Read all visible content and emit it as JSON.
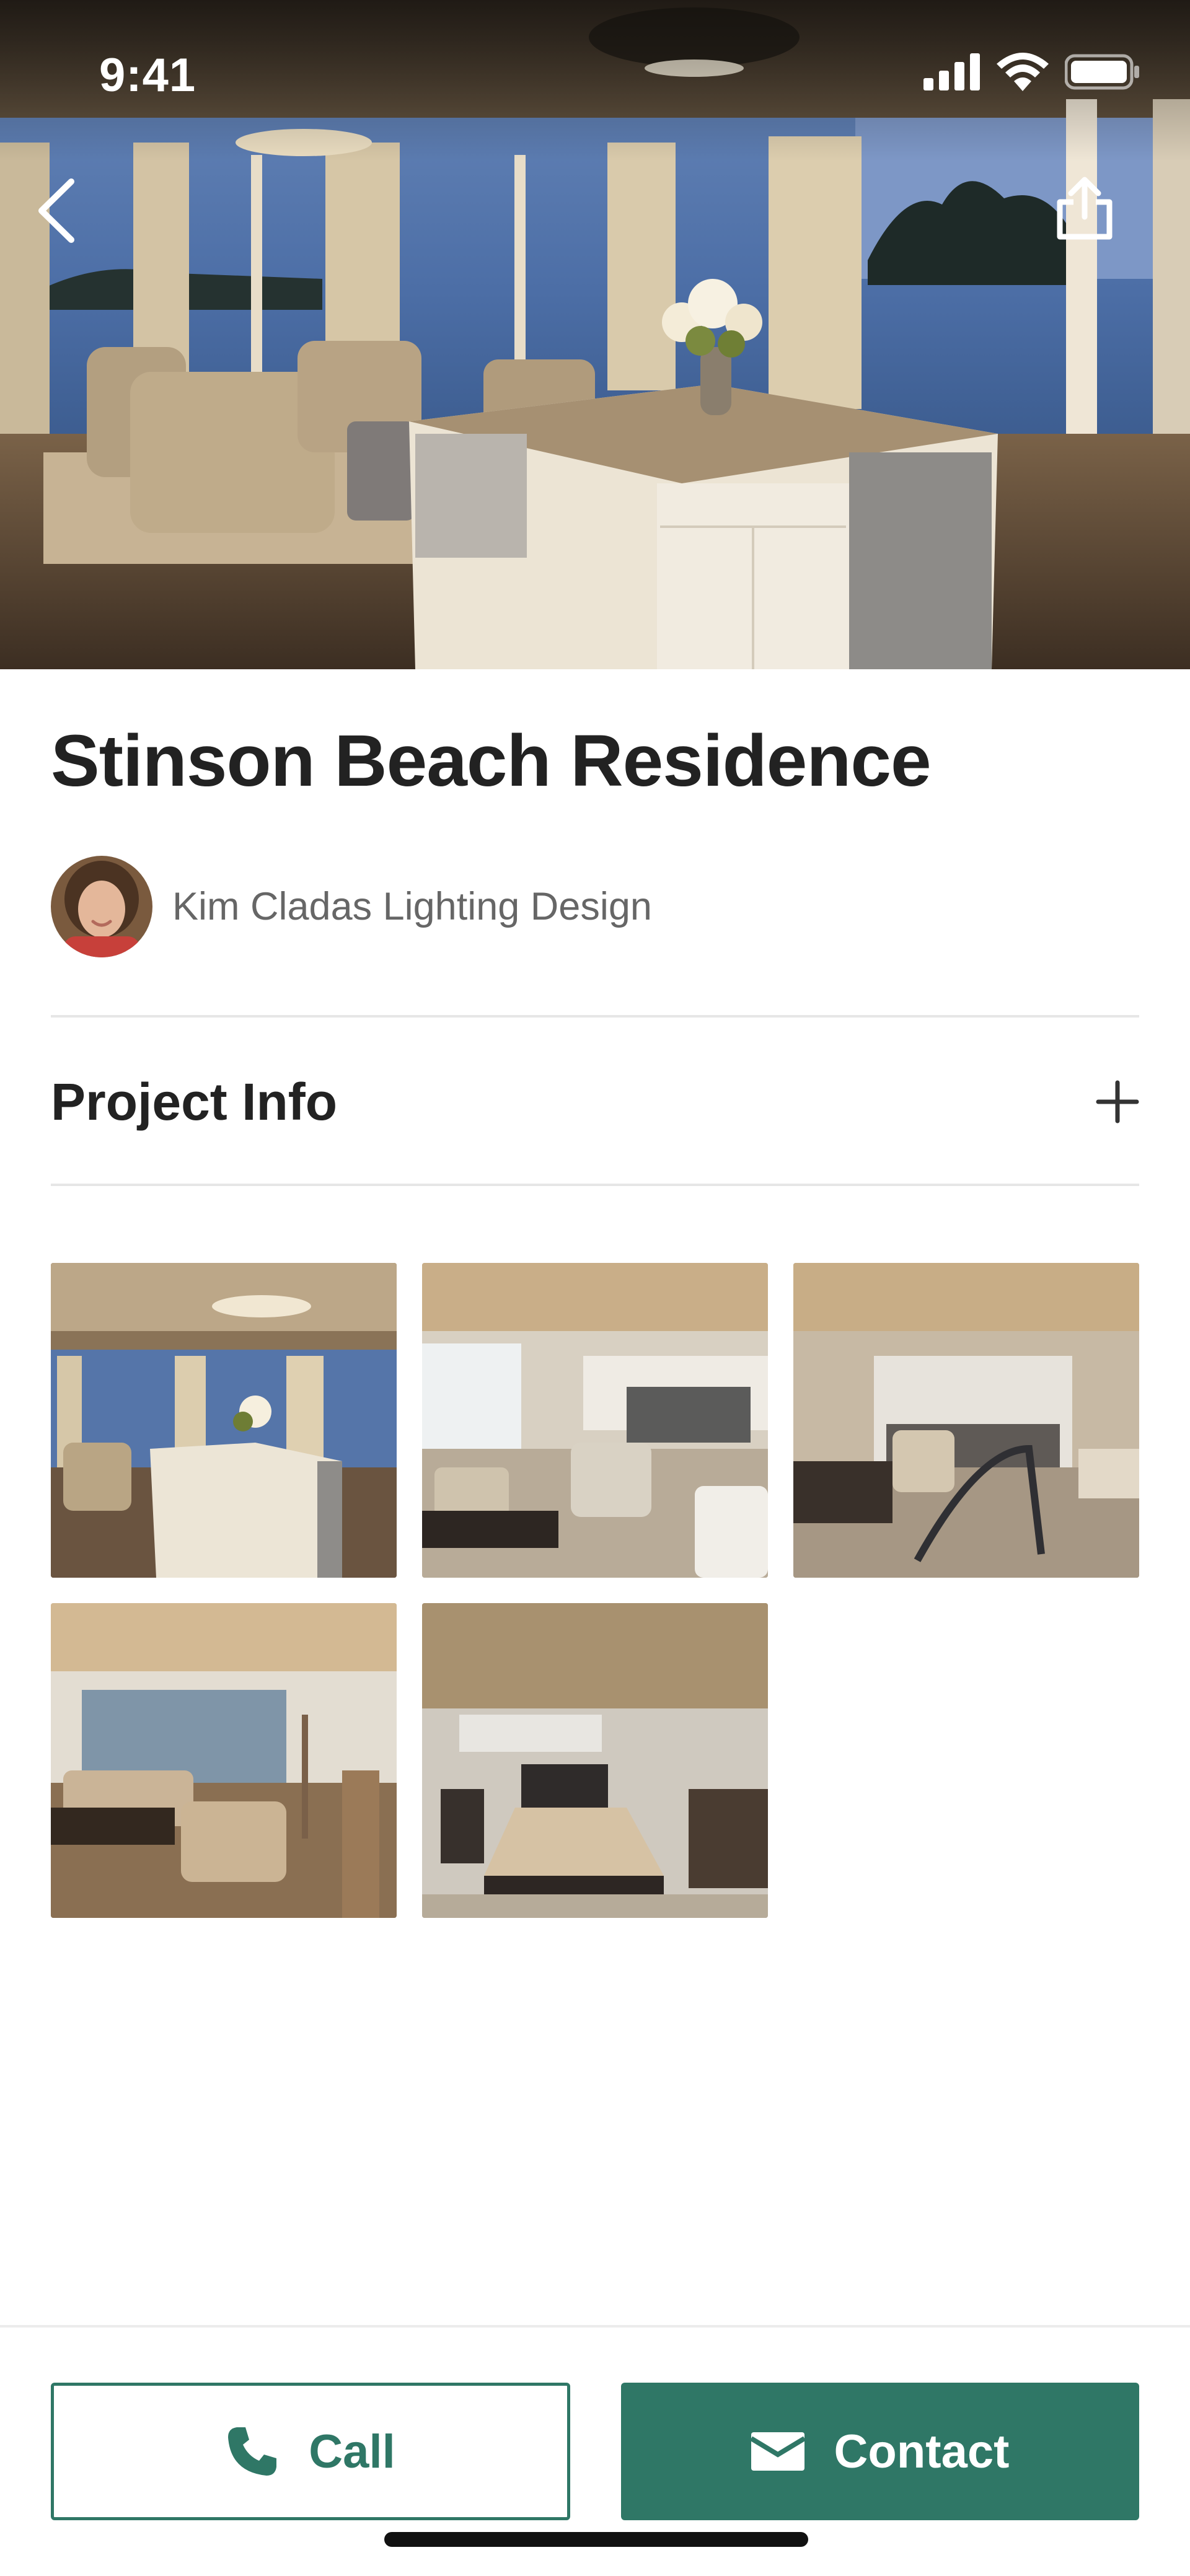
{
  "status_bar": {
    "time": "9:41",
    "icons": [
      "signal-icon",
      "wifi-icon",
      "battery-icon"
    ]
  },
  "hero": {
    "back_icon": "chevron-left-icon",
    "share_icon": "share-icon"
  },
  "project": {
    "title": "Stinson Beach Residence",
    "author": "Kim Cladas Lighting Design"
  },
  "project_info": {
    "label": "Project Info",
    "expand_icon": "plus-icon"
  },
  "gallery": {
    "count": 5
  },
  "actions": {
    "call_label": "Call",
    "call_icon": "phone-icon",
    "contact_label": "Contact",
    "contact_icon": "envelope-icon"
  },
  "colors": {
    "accent": "#2f7766",
    "title": "#222222",
    "muted": "#666666",
    "divider": "#e6e6e6"
  }
}
